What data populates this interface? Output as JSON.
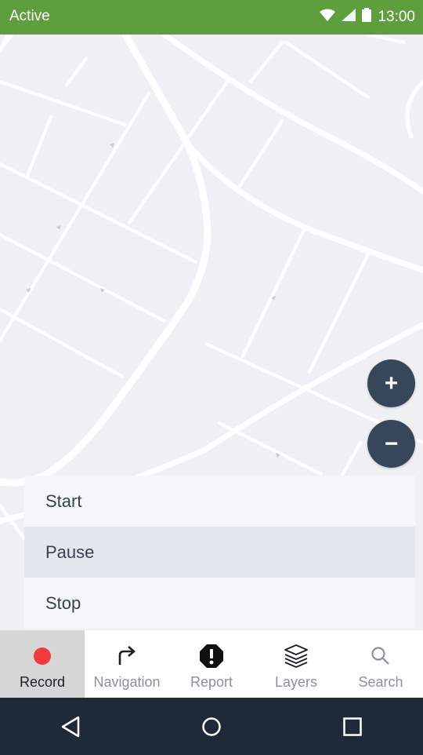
{
  "status_bar": {
    "title": "Active",
    "time": "13:00",
    "icons": [
      "wifi-icon",
      "signal-icon",
      "battery-icon"
    ],
    "color": "#5e9e3c"
  },
  "map": {
    "zoom_in_label": "+",
    "zoom_out_label": "−",
    "background": "#eef0f4"
  },
  "menu": {
    "items": [
      {
        "label": "Start"
      },
      {
        "label": "Pause",
        "selected": true
      },
      {
        "label": "Stop"
      }
    ]
  },
  "bottom_nav": {
    "items": [
      {
        "label": "Record",
        "icon": "record-dot-icon",
        "active": true
      },
      {
        "label": "Navigation",
        "icon": "turn-right-arrow-icon"
      },
      {
        "label": "Report",
        "icon": "alert-octagon-icon"
      },
      {
        "label": "Layers",
        "icon": "layers-icon"
      },
      {
        "label": "Search",
        "icon": "search-icon"
      }
    ],
    "record_color": "#f23a3a"
  },
  "system_nav": {
    "buttons": [
      "back-icon",
      "home-icon",
      "recents-icon"
    ],
    "background": "#1f2a38"
  }
}
